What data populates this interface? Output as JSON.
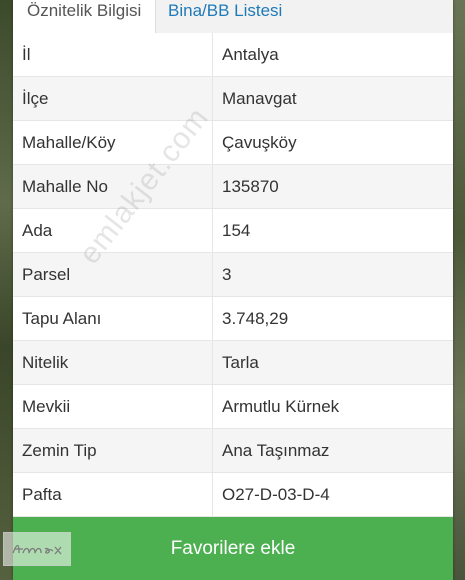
{
  "tabs": [
    {
      "label": "Öznitelik Bilgisi",
      "active": true
    },
    {
      "label": "Bina/BB Listesi",
      "active": false
    }
  ],
  "rows": [
    {
      "label": "İl",
      "value": "Antalya"
    },
    {
      "label": "İlçe",
      "value": "Manavgat"
    },
    {
      "label": "Mahalle/Köy",
      "value": "Çavuşköy"
    },
    {
      "label": "Mahalle No",
      "value": "135870"
    },
    {
      "label": "Ada",
      "value": "154"
    },
    {
      "label": "Parsel",
      "value": "3"
    },
    {
      "label": "Tapu Alanı",
      "value": "3.748,29"
    },
    {
      "label": "Nitelik",
      "value": "Tarla"
    },
    {
      "label": "Mevkii",
      "value": "Armutlu Kürnek"
    },
    {
      "label": "Zemin Tip",
      "value": "Ana Taşınmaz"
    },
    {
      "label": "Pafta",
      "value": "O27-D-03-D-4"
    }
  ],
  "favorite_button": {
    "label": "Favorilere ekle"
  },
  "watermark": "emlakjet.com",
  "logo_text": "Hamax",
  "colors": {
    "accent_green": "#4cb050",
    "tab_link": "#1f7ab8"
  }
}
